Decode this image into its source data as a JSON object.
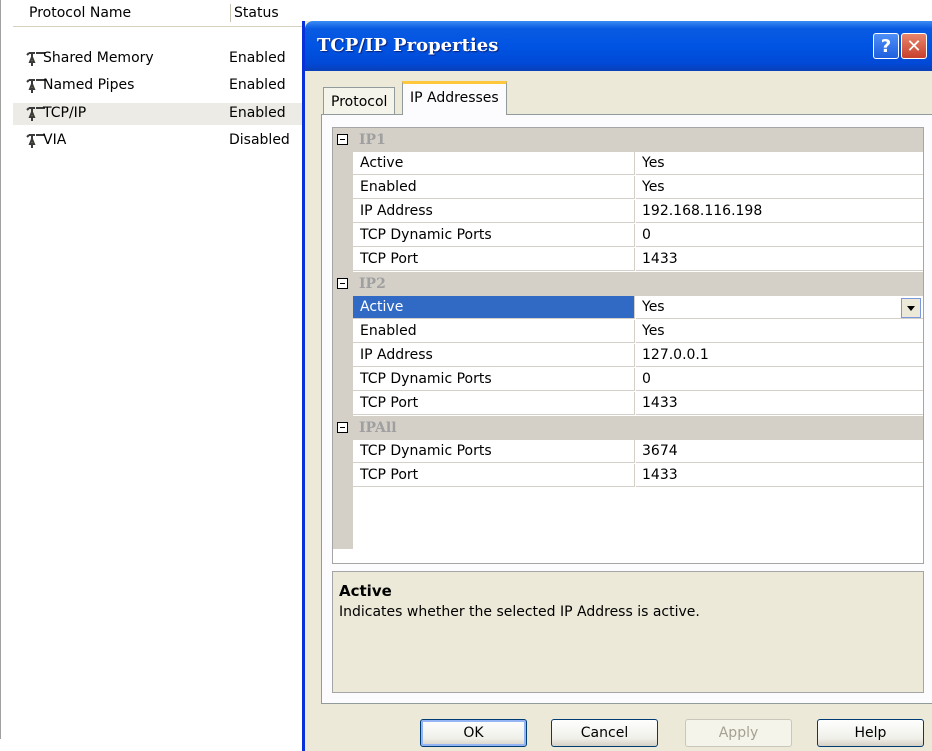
{
  "protocol_list": {
    "headers": {
      "name": "Protocol Name",
      "status": "Status"
    },
    "rows": [
      {
        "name": "Shared Memory",
        "status": "Enabled"
      },
      {
        "name": "Named Pipes",
        "status": "Enabled"
      },
      {
        "name": "TCP/IP",
        "status": "Enabled"
      },
      {
        "name": "VIA",
        "status": "Disabled"
      }
    ]
  },
  "dialog": {
    "title": "TCP/IP Properties",
    "help_glyph": "?",
    "close_glyph": "✕",
    "tabs": [
      {
        "label": "Protocol"
      },
      {
        "label": "IP Addresses"
      }
    ],
    "sections": [
      {
        "label": "IP1",
        "props": [
          {
            "name": "Active",
            "value": "Yes"
          },
          {
            "name": "Enabled",
            "value": "Yes"
          },
          {
            "name": "IP Address",
            "value": "192.168.116.198"
          },
          {
            "name": "TCP Dynamic Ports",
            "value": "0"
          },
          {
            "name": "TCP Port",
            "value": "1433"
          }
        ]
      },
      {
        "label": "IP2",
        "props": [
          {
            "name": "Active",
            "value": "Yes"
          },
          {
            "name": "Enabled",
            "value": "Yes"
          },
          {
            "name": "IP Address",
            "value": "127.0.0.1"
          },
          {
            "name": "TCP Dynamic Ports",
            "value": "0"
          },
          {
            "name": "TCP Port",
            "value": "1433"
          }
        ]
      },
      {
        "label": "IPAll",
        "props": [
          {
            "name": "TCP Dynamic Ports",
            "value": "3674"
          },
          {
            "name": "TCP Port",
            "value": "1433"
          }
        ]
      }
    ],
    "description": {
      "title": "Active",
      "text": "Indicates whether the selected IP Address is active."
    },
    "buttons": {
      "ok": "OK",
      "cancel": "Cancel",
      "apply": "Apply",
      "help": "Help"
    }
  },
  "colors": {
    "titlebar": "#0054e3",
    "selection": "#316ac5",
    "dialog_bg": "#ece9d8",
    "tab_highlight": "#ffc83c"
  },
  "icons": {
    "protocol_row": "network-plug-icon",
    "collapse": "collapse-minus-icon",
    "dropdown": "chevron-down-icon"
  }
}
